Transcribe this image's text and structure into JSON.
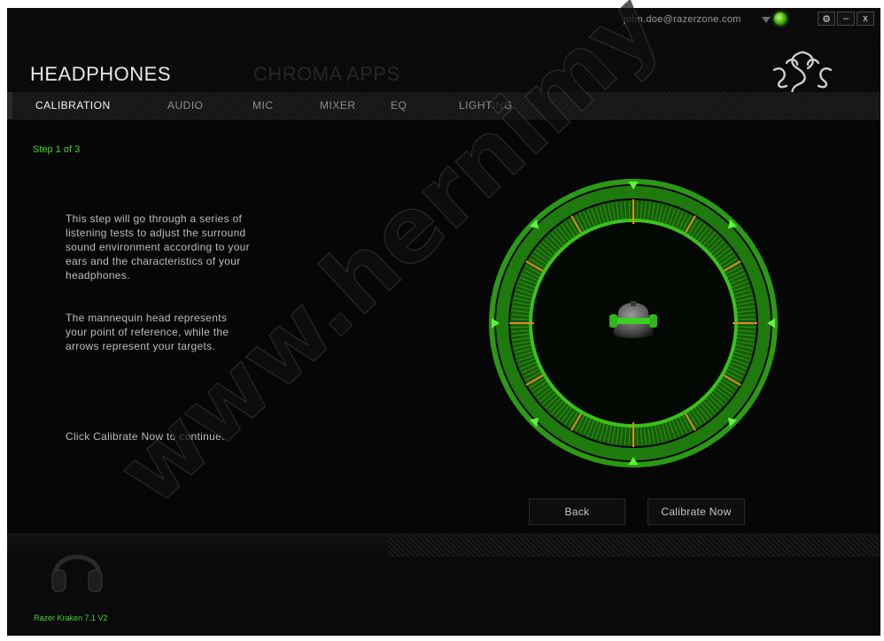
{
  "header": {
    "title": "HEADPHONES",
    "secondary_title": "CHROMA APPS",
    "account_email": "john.doe@razerzone.com",
    "window_buttons": [
      "⚙",
      "–",
      "x"
    ]
  },
  "tabs": [
    {
      "label": "CALIBRATION",
      "active": true
    },
    {
      "label": "AUDIO",
      "active": false
    },
    {
      "label": "MIC",
      "active": false
    },
    {
      "label": "MIXER",
      "active": false
    },
    {
      "label": "EQ",
      "active": false
    },
    {
      "label": "LIGHTING",
      "active": false
    }
  ],
  "main": {
    "step": "Step 1 of 3",
    "paragraph1": [
      "This step will go through a series of",
      "listening tests to adjust the surround",
      "sound environment according to your",
      "ears and the characteristics of your",
      "headphones."
    ],
    "paragraph2": [
      "The mannequin head represents",
      "your point of reference, while the",
      "arrows represent your targets."
    ],
    "instruction": "Click Calibrate Now to continue.",
    "back_label": "Back",
    "calibrate_label": "Calibrate Now"
  },
  "footer": {
    "device_name": "Razer Kraken 7.1 V2"
  },
  "watermark": "www.hernimy",
  "colors": {
    "accent": "#44d62c",
    "marker": "#e08a1e",
    "background": "#060606"
  },
  "icons": {
    "status": "status-indicator-icon",
    "logo": "razer-snake-logo-icon",
    "headset": "headset-icon",
    "head": "mannequin-head-icon"
  }
}
